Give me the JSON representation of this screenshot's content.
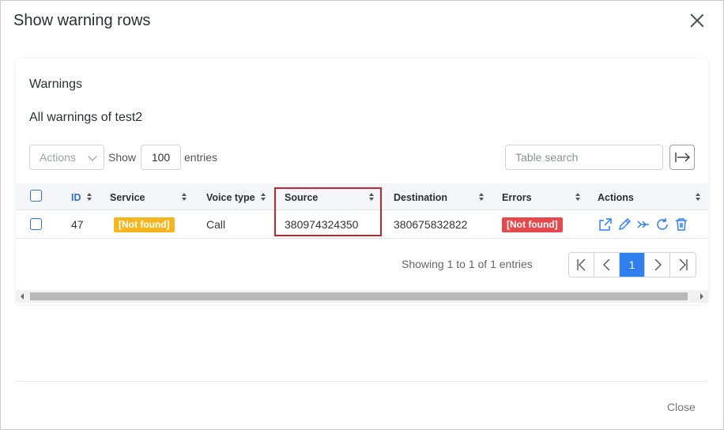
{
  "modal": {
    "title": "Show warning rows",
    "close_label": "Close"
  },
  "card": {
    "title": "Warnings",
    "subtitle": "All warnings of test2"
  },
  "toolbar": {
    "actions_placeholder": "Actions",
    "show_label": "Show",
    "entries_value": "100",
    "entries_label": "entries",
    "search_placeholder": "Table search"
  },
  "table": {
    "columns": [
      "ID",
      "Service",
      "Voice type",
      "Source",
      "Destination",
      "Errors",
      "Actions"
    ],
    "rows": [
      {
        "id": "47",
        "service": "[Not found]",
        "voice_type": "Call",
        "source": "380974324350",
        "destination": "380675832822",
        "errors": "[Not found]"
      }
    ],
    "row_action_icons": [
      "external-link-icon",
      "pencil-icon",
      "merge-arrows-icon",
      "refresh-icon",
      "trash-icon"
    ]
  },
  "footer": {
    "showing": "Showing 1 to 1 of 1 entries",
    "current_page": "1"
  },
  "colors": {
    "primary": "#2f80ed",
    "warning_badge": "#f5b51e",
    "error_badge": "#e5484d",
    "highlight": "#c8252c"
  }
}
